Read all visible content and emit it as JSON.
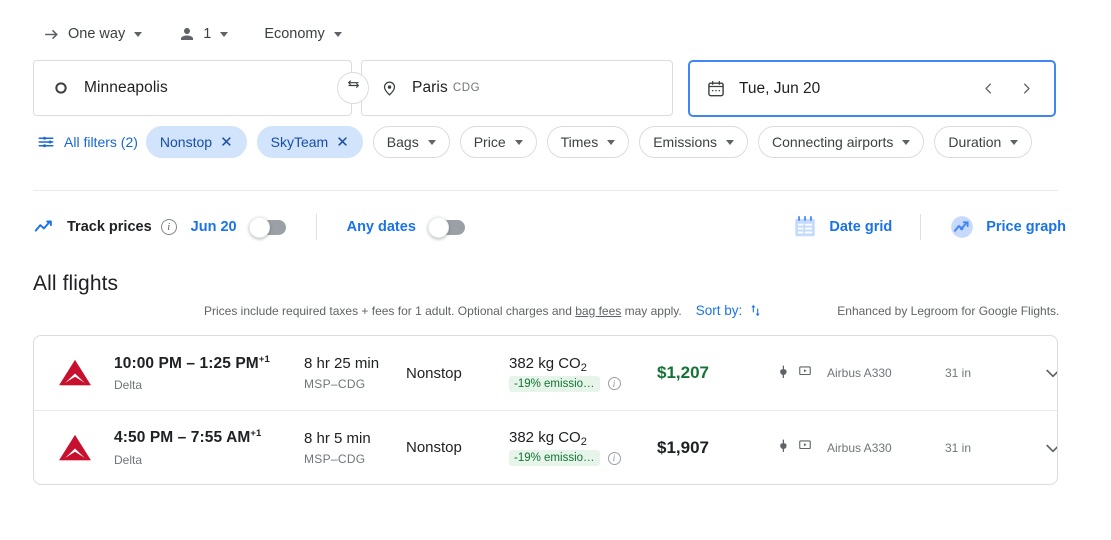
{
  "trip_options": {
    "trip_type": {
      "label": "One way",
      "icon": "arrow-right-icon"
    },
    "passengers": {
      "label": "1",
      "icon": "person-icon"
    },
    "cabin_class": {
      "label": "Economy"
    }
  },
  "search": {
    "origin": {
      "value": "Minneapolis",
      "icon": "circle-outline-icon"
    },
    "destination": {
      "value": "Paris",
      "code": "CDG",
      "icon": "location-pin-icon"
    },
    "swap_icon": "swap-arrows-icon",
    "date": {
      "value": "Tue, Jun 20",
      "icon": "calendar-icon",
      "prev": "‹",
      "next": "›"
    }
  },
  "filters": {
    "all_filters_label": "All filters (2)",
    "all_filters_icon": "tune-sliders-icon",
    "chips": [
      {
        "label": "Nonstop",
        "active": true,
        "removable": true
      },
      {
        "label": "SkyTeam",
        "active": true,
        "removable": true
      },
      {
        "label": "Bags",
        "active": false,
        "removable": false
      },
      {
        "label": "Price",
        "active": false,
        "removable": false
      },
      {
        "label": "Times",
        "active": false,
        "removable": false
      },
      {
        "label": "Emissions",
        "active": false,
        "removable": false
      },
      {
        "label": "Connecting airports",
        "active": false,
        "removable": false
      },
      {
        "label": "Duration",
        "active": false,
        "removable": false
      }
    ]
  },
  "track_prices": {
    "icon": "trending-line-icon",
    "label": "Track prices",
    "info_icon": "info-icon",
    "date_label": "Jun 20",
    "date_toggle_on": false,
    "any_dates_label": "Any dates",
    "any_dates_toggle_on": false
  },
  "view_tools": [
    {
      "label": "Date grid",
      "icon": "date-grid-icon"
    },
    {
      "label": "Price graph",
      "icon": "price-graph-icon"
    }
  ],
  "results": {
    "heading": "All flights",
    "disclaimer_pre": "Prices include required taxes + fees for 1 adult. Optional charges and ",
    "disclaimer_link": "bag fees",
    "disclaimer_post": " may apply.",
    "sort_by_label": "Sort by:",
    "sort_icon": "sort-arrows-icon",
    "enhanced_note": "Enhanced by Legroom for Google Flights.",
    "flights": [
      {
        "airline_logo": "delta-logo-icon",
        "times": "10:00 PM – 1:25 PM",
        "day_offset": "+1",
        "carrier": "Delta",
        "duration": "8 hr 25 min",
        "route": "MSP–CDG",
        "stops": "Nonstop",
        "emissions": "382 kg CO",
        "emissions_sub": "2",
        "emissions_badge": "-19% emissio…",
        "emissions_info_icon": "info-icon",
        "price": "$1,207",
        "price_highlight": true,
        "amenities": [
          "power-outlet-icon",
          "in-flight-video-icon"
        ],
        "aircraft": "Airbus A330",
        "legroom": "31 in",
        "expand_icon": "chevron-down-icon"
      },
      {
        "airline_logo": "delta-logo-icon",
        "times": "4:50 PM – 7:55 AM",
        "day_offset": "+1",
        "carrier": "Delta",
        "duration": "8 hr 5 min",
        "route": "MSP–CDG",
        "stops": "Nonstop",
        "emissions": "382 kg CO",
        "emissions_sub": "2",
        "emissions_badge": "-19% emissio…",
        "emissions_info_icon": "info-icon",
        "price": "$1,907",
        "price_highlight": false,
        "amenities": [
          "power-outlet-icon",
          "in-flight-video-icon"
        ],
        "aircraft": "Airbus A330",
        "legroom": "31 in",
        "expand_icon": "chevron-down-icon"
      }
    ]
  },
  "colors": {
    "accent_blue": "#1a73e8",
    "chip_active_bg": "#d2e3fc",
    "price_green": "#137333",
    "emissions_badge_bg": "#e6f4ea",
    "delta_red": "#c8102e"
  }
}
